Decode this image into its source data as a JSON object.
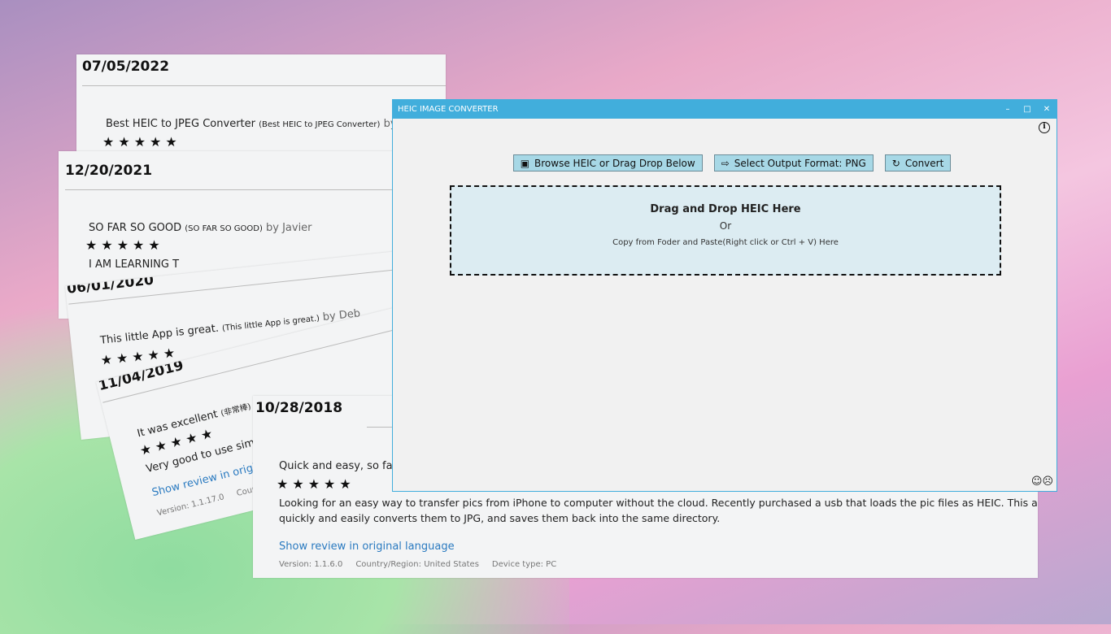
{
  "reviews": [
    {
      "date": "07/05/2022",
      "title": "Best HEIC to JPEG Converter",
      "title_original": "(Best HEIC to JPEG Converter)",
      "by": "by S",
      "stars": "★★★★★",
      "rating": 5
    },
    {
      "date": "12/20/2021",
      "title": "SO FAR SO GOOD",
      "title_original": "(SO FAR SO GOOD)",
      "by": "by Javier",
      "stars": "★★★★★",
      "rating": 5,
      "body": "I AM LEARNING T"
    },
    {
      "date": "06/01/2020",
      "title": "This little App is great.",
      "title_original": "(This little App is great.)",
      "by": "by Deb",
      "stars": "★★★★★",
      "rating": 5
    },
    {
      "date": "11/04/2019",
      "title": "It was excellent",
      "title_original": "(非常棒)",
      "by": "b",
      "stars": "★★★★★",
      "rating": 5,
      "body": "Very good to use simp",
      "link": "Show review in origin",
      "version": "Version: 1.1.17.0",
      "country": "Countr"
    },
    {
      "date": "10/28/2018",
      "title": "Quick and easy, so far",
      "stars": "★★★★★",
      "rating": 5,
      "body_line1": "Looking for an easy way to transfer pics from iPhone to computer without the cloud. Recently purchased a usb that loads the pic files as HEIC. This app",
      "body_line2": "quickly and easily converts them to JPG, and saves them back into the same directory.",
      "link": "Show review in original language",
      "version": "Version: 1.1.6.0",
      "country": "Country/Region: United States",
      "device": "Device type: PC"
    }
  ],
  "app": {
    "title": "HEIC IMAGE CONVERTER",
    "controls": {
      "minimize": "–",
      "maximize": "□",
      "close": "✕"
    },
    "info": "i",
    "toolbar": {
      "browse": "Browse HEIC or Drag Drop Below",
      "format": "Select Output Format: PNG",
      "convert": "Convert"
    },
    "drop": {
      "heading": "Drag and Drop HEIC Here",
      "or": "Or",
      "sub": "Copy from Foder and Paste(Right click or Ctrl + V) Here"
    },
    "feedback": {
      "happy": "☺",
      "sad": "☹"
    }
  },
  "colors": {
    "titlebar": "#41aedc",
    "button": "#a7d8e6",
    "drop_bg": "#dcecf2",
    "link": "#2a7ac0"
  }
}
